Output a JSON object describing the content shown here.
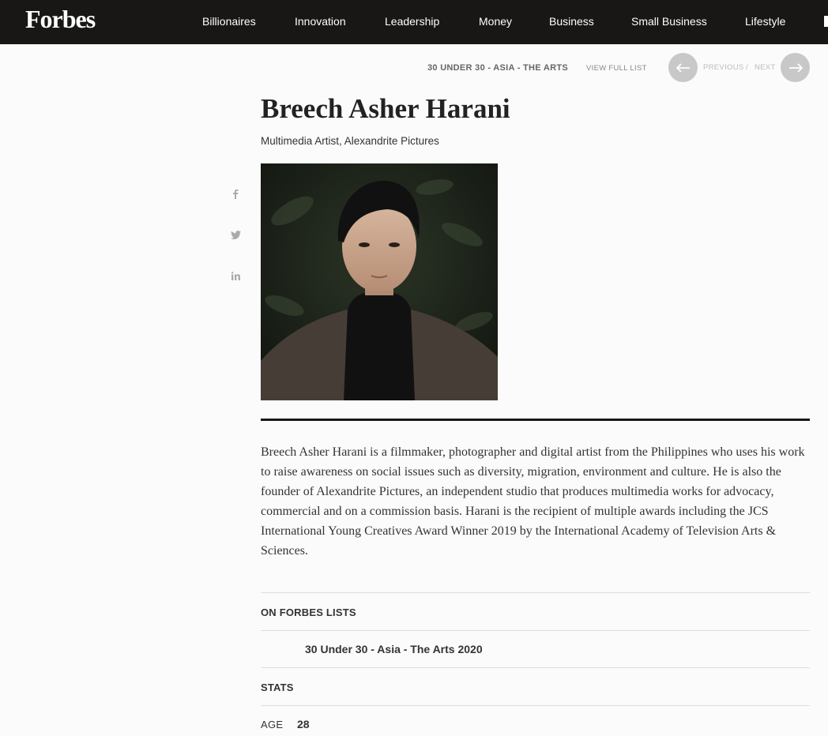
{
  "header": {
    "logo": "Forbes",
    "nav": [
      "Billionaires",
      "Innovation",
      "Leadership",
      "Money",
      "Business",
      "Small Business",
      "Lifestyle"
    ]
  },
  "list_nav": {
    "list_title": "30 UNDER 30 - ASIA - THE ARTS",
    "view_full_list": "VIEW FULL LIST",
    "previous": "PREVIOUS",
    "separator": "/",
    "next": "NEXT"
  },
  "profile": {
    "name": "Breech Asher Harani",
    "title": "Multimedia Artist, Alexandrite Pictures",
    "bio": "Breech Asher Harani is a filmmaker, photographer and digital artist from the Philippines who uses his work to raise awareness on social issues such as diversity, migration, environment and culture. He is also the founder of Alexandrite Pictures, an independent studio that produces multimedia works for advocacy, commercial and on a commission basis. Harani is the recipient of multiple awards including the JCS International Young Creatives Award Winner 2019 by the International Academy of Television Arts & Sciences."
  },
  "share": {
    "icons": [
      "facebook-icon",
      "twitter-icon",
      "linkedin-icon"
    ]
  },
  "lists_section": {
    "heading": "ON FORBES LISTS",
    "items": [
      "30 Under 30 - Asia - The Arts 2020"
    ]
  },
  "stats_section": {
    "heading": "STATS",
    "age_label": "AGE",
    "age_value": "28"
  }
}
